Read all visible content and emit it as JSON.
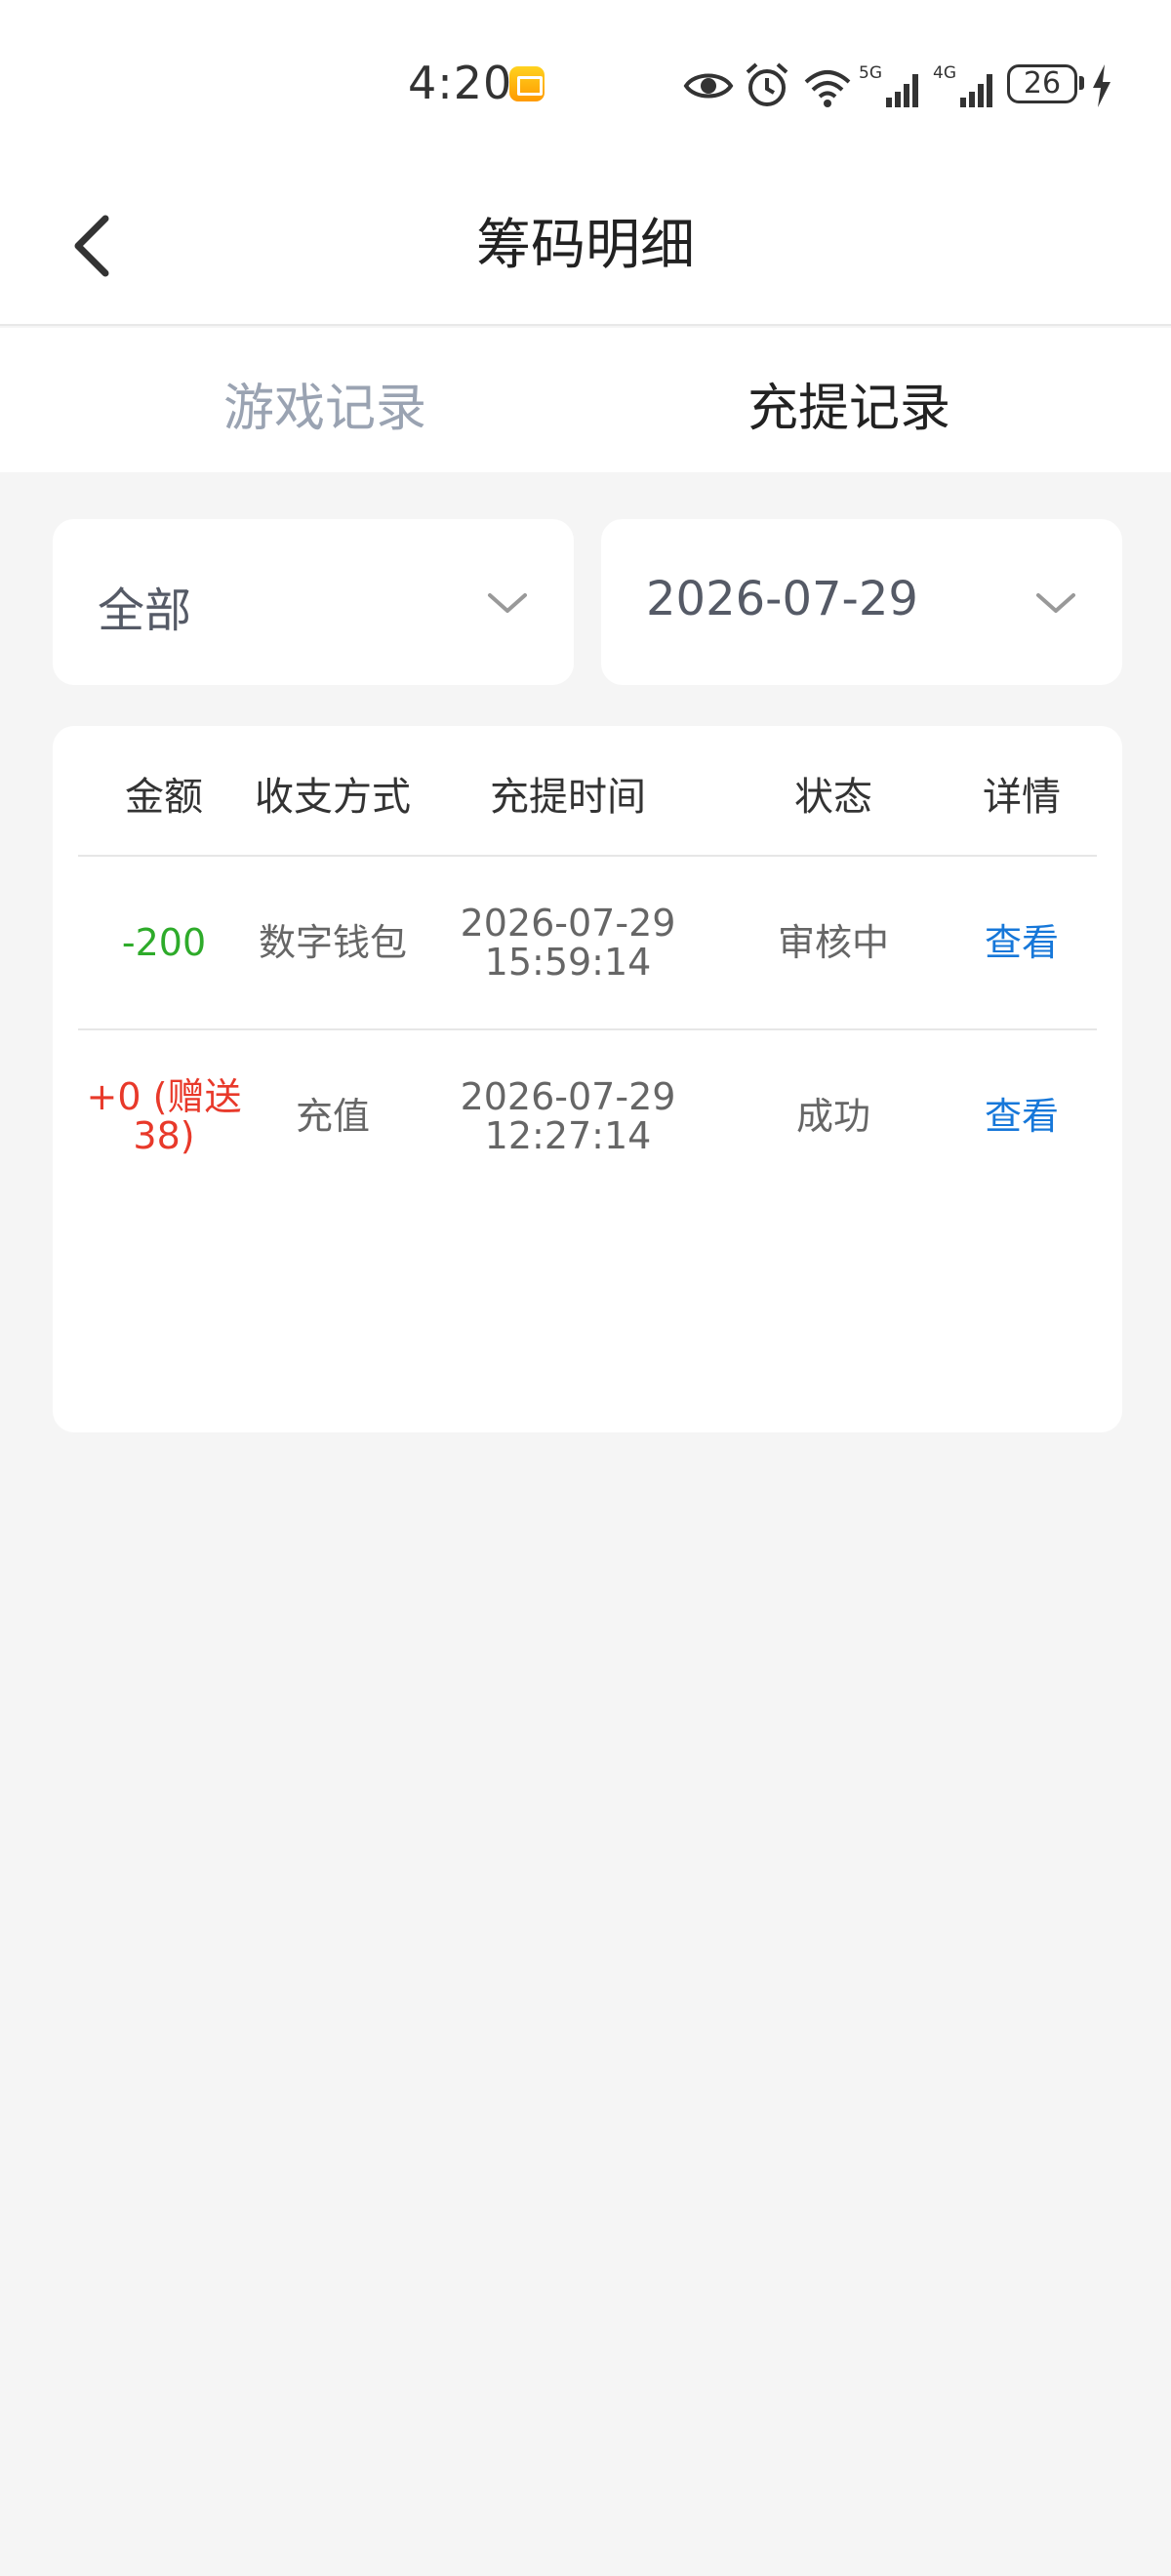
{
  "status_bar": {
    "time": "4:20",
    "battery": "26",
    "icons": [
      "eye-icon",
      "alarm-icon",
      "wifi-icon",
      "signal-5g-icon",
      "signal-4g-icon",
      "charging-icon"
    ]
  },
  "nav": {
    "title": "筹码明细"
  },
  "tabs": [
    {
      "label": "游戏记录",
      "active": false
    },
    {
      "label": "充提记录",
      "active": true
    }
  ],
  "filters": {
    "type": "全部",
    "date": "2026-07-29"
  },
  "table": {
    "headers": [
      "金额",
      "收支方式",
      "充提时间",
      "状态",
      "详情"
    ],
    "rows": [
      {
        "amount": "-200",
        "method": "数字钱包",
        "time": "2026-07-29\n15:59:14",
        "status": "审核中",
        "detail": "查看"
      },
      {
        "amount": "+0 (赠送38)",
        "method": "充值",
        "time": "2026-07-29\n12:27:14",
        "status": "成功",
        "detail": "查看"
      }
    ]
  },
  "colors": {
    "negative": "#2eab2a",
    "positive": "#e8392a",
    "link": "#1677d9",
    "tab_inactive": "#9aa3b2",
    "background": "#f5f5f5"
  }
}
